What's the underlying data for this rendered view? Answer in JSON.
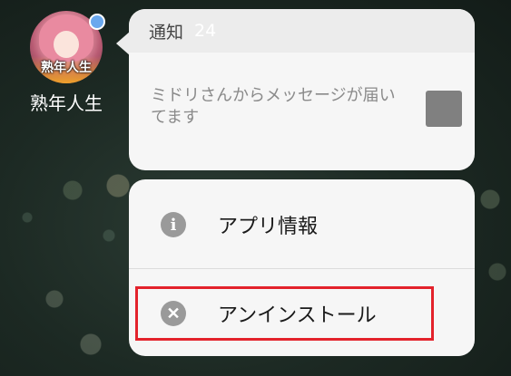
{
  "app": {
    "icon_text": "熟年人生",
    "name": "熟年人生",
    "badge_color": "#6aa8ee"
  },
  "notification": {
    "header_label": "通知",
    "count": "24",
    "message": "ミドリさんからメッセージが届いてます",
    "thumbnail": "gray-square-thumbnail"
  },
  "menu": {
    "items": [
      {
        "icon": "info-icon",
        "glyph": "i",
        "label": "アプリ情報"
      },
      {
        "icon": "close-circle-icon",
        "glyph": "✕",
        "label": "アンインストール"
      }
    ]
  },
  "highlight": {
    "target": "uninstall",
    "color": "#e3222b"
  }
}
